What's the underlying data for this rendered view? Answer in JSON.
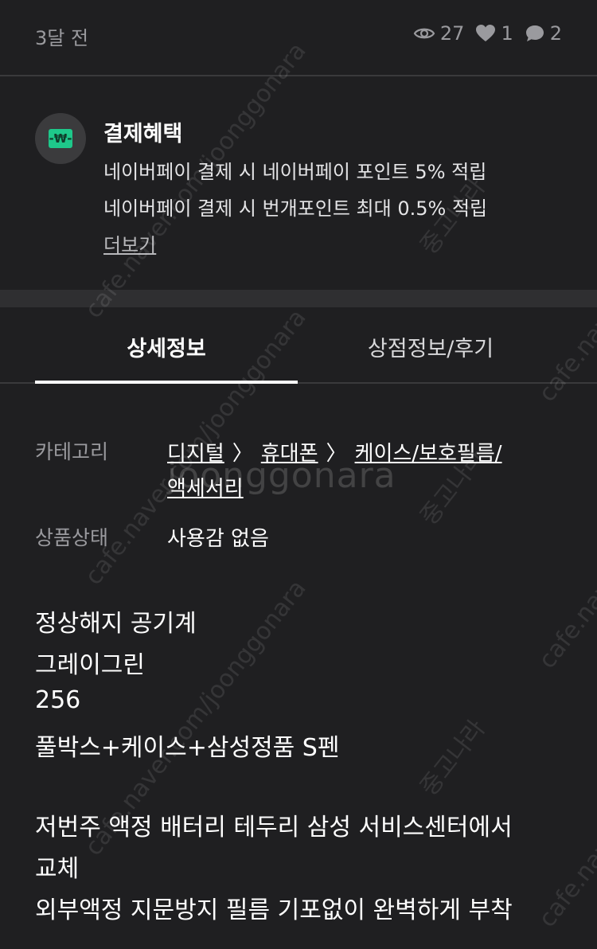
{
  "meta": {
    "time": "3달 전",
    "views": "27",
    "likes": "1",
    "comments": "2"
  },
  "benefit": {
    "title": "결제혜택",
    "lines": [
      "네이버페이 결제 시 네이버페이 포인트 5% 적립",
      "네이버페이 결제 시 번개포인트 최대 0.5% 적립"
    ],
    "more": "더보기",
    "logo_icon": "naverpay-won-icon",
    "logo_color": "#1ec88a"
  },
  "tabs": [
    {
      "label": "상세정보",
      "active": true
    },
    {
      "label": "상점정보/후기",
      "active": false
    }
  ],
  "info": {
    "category_label": "카테고리",
    "category": [
      "디지털",
      "휴대폰",
      "케이스/보호필름/",
      "액세서리"
    ],
    "separator": "〉",
    "condition_label": "상품상태",
    "condition": "사용감 없음"
  },
  "description": [
    "정상해지 공기계",
    "그레이그린",
    "256",
    "풀박스+케이스+삼성정품 S펜",
    "",
    "저번주 액정 배터리 테두리 삼성 서비스센터에서",
    "교체",
    "외부액정 지문방지 필름 기포없이 완벽하게 부착"
  ],
  "watermarks": {
    "center": "joonggonara",
    "url": "cafe.naver.com/joonggonara",
    "small": "cafe.nave",
    "korean": "중고나라"
  },
  "colors": {
    "background": "#1f1f21",
    "muted_text": "#9a9a9e",
    "divider": "#3a3a3c"
  }
}
